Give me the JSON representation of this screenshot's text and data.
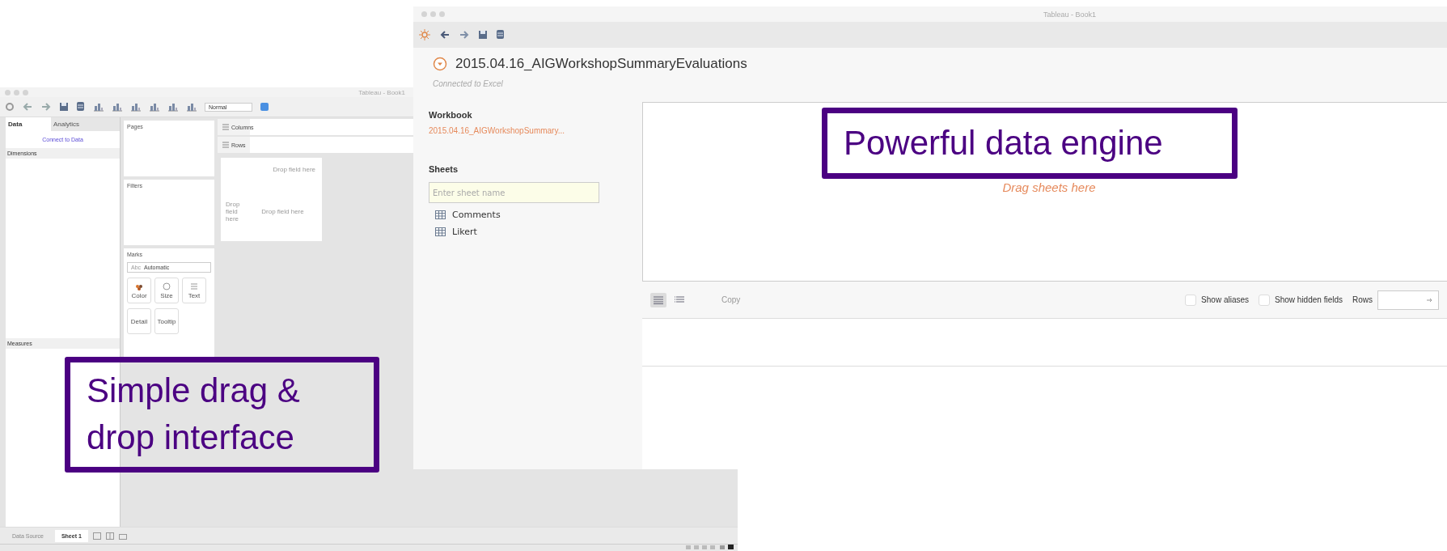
{
  "back_window": {
    "title": "Tableau - Book1",
    "view_mode": "Normal",
    "data_tabs": [
      {
        "label": "Data",
        "selected": true
      },
      {
        "label": "Analytics",
        "selected": false
      }
    ],
    "connect_link": "Connect to Data",
    "dimensions_header": "Dimensions",
    "measures_header": "Measures",
    "pages_shelf": "Pages",
    "filters_shelf": "Filters",
    "marks": {
      "title": "Marks",
      "type_prefix": "Abc",
      "type": "Automatic",
      "buttons": [
        {
          "label": "Color",
          "kind": "color"
        },
        {
          "label": "Size",
          "kind": "size"
        },
        {
          "label": "Text",
          "kind": "text"
        },
        {
          "label": "Detail",
          "kind": "detail"
        },
        {
          "label": "Tooltip",
          "kind": "tooltip"
        }
      ]
    },
    "columns_shelf": "Columns",
    "rows_shelf": "Rows",
    "canvas": {
      "top_drop": "Drop field here",
      "left_drop": "Drop field here",
      "center_drop": "Drop field here"
    },
    "sheet_tabs": [
      {
        "label": "Data Source",
        "selected": false
      },
      {
        "label": "Sheet 1",
        "selected": true
      }
    ]
  },
  "front_window": {
    "title": "Tableau - Book1",
    "connection_name": "2015.04.16_AIGWorkshopSummaryEvaluations",
    "connection_status": "Connected to Excel",
    "workbook_header": "Workbook",
    "workbook_file": "2015.04.16_AIGWorkshopSummary...",
    "sheets_header": "Sheets",
    "sheet_search": {
      "placeholder": "Enter sheet name"
    },
    "sheets": [
      {
        "label": "Comments"
      },
      {
        "label": "Likert"
      }
    ],
    "drop_hint": "Drag sheets here",
    "grid_views": [
      {
        "selected": true
      },
      {
        "selected": false
      }
    ],
    "copy_button": "Copy",
    "options": [
      {
        "label": "Show aliases",
        "checked": false
      },
      {
        "label": "Show hidden fields",
        "checked": false
      }
    ],
    "rows_label": "Rows"
  },
  "callouts": [
    {
      "text": "Simple drag & drop interface"
    },
    {
      "text": "Powerful data engine"
    }
  ]
}
